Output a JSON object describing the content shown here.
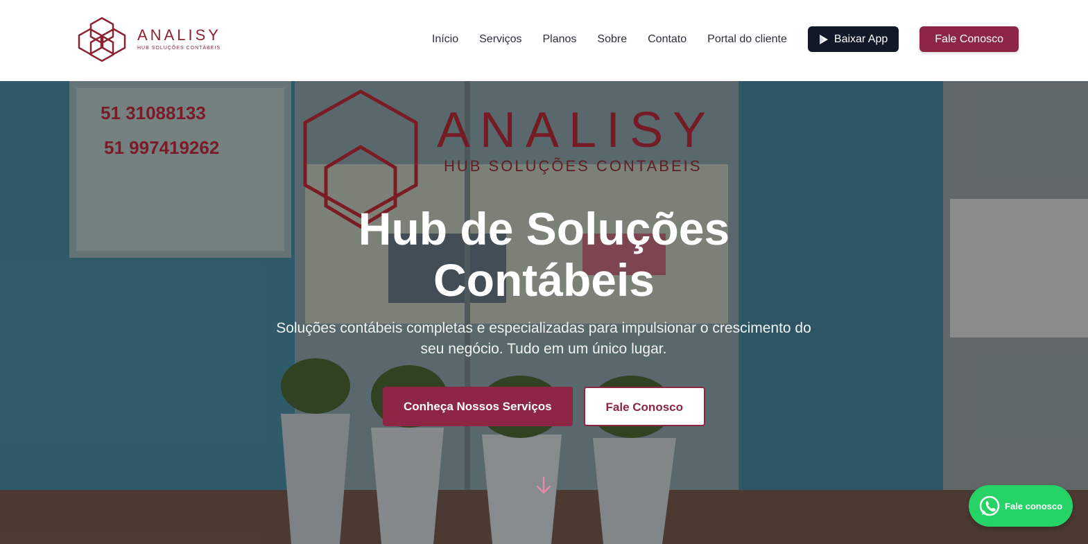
{
  "brand": {
    "name": "ANALISY",
    "tagline": "HUB SOLUÇÕES CONTÁBEIS",
    "color": "#8b2232"
  },
  "nav": {
    "items": [
      "Início",
      "Serviços",
      "Planos",
      "Sobre",
      "Contato",
      "Portal do cliente"
    ],
    "app_button": "Baixar App",
    "contact_button": "Fale Conosco"
  },
  "hero": {
    "title_line1": "Hub de Soluções",
    "title_line2": "Contábeis",
    "subtitle": "Soluções contábeis completas e especializadas para impulsionar o crescimento do seu negócio. Tudo em um único lugar.",
    "primary_button": "Conheça Nossos Serviços",
    "secondary_button": "Fale Conosco",
    "scroll_icon": "arrow-down-icon",
    "background_sign": {
      "phone1": "51 31088133",
      "phone2": "51 997419262",
      "brand": "ANALISY",
      "sub": "HUB SOLUÇÕES CONTABEIS"
    }
  },
  "whatsapp": {
    "label": "Fale conosco",
    "icon": "whatsapp-icon",
    "color": "#25d366"
  },
  "colors": {
    "accent": "#8d2645",
    "dark_button": "#111827"
  }
}
